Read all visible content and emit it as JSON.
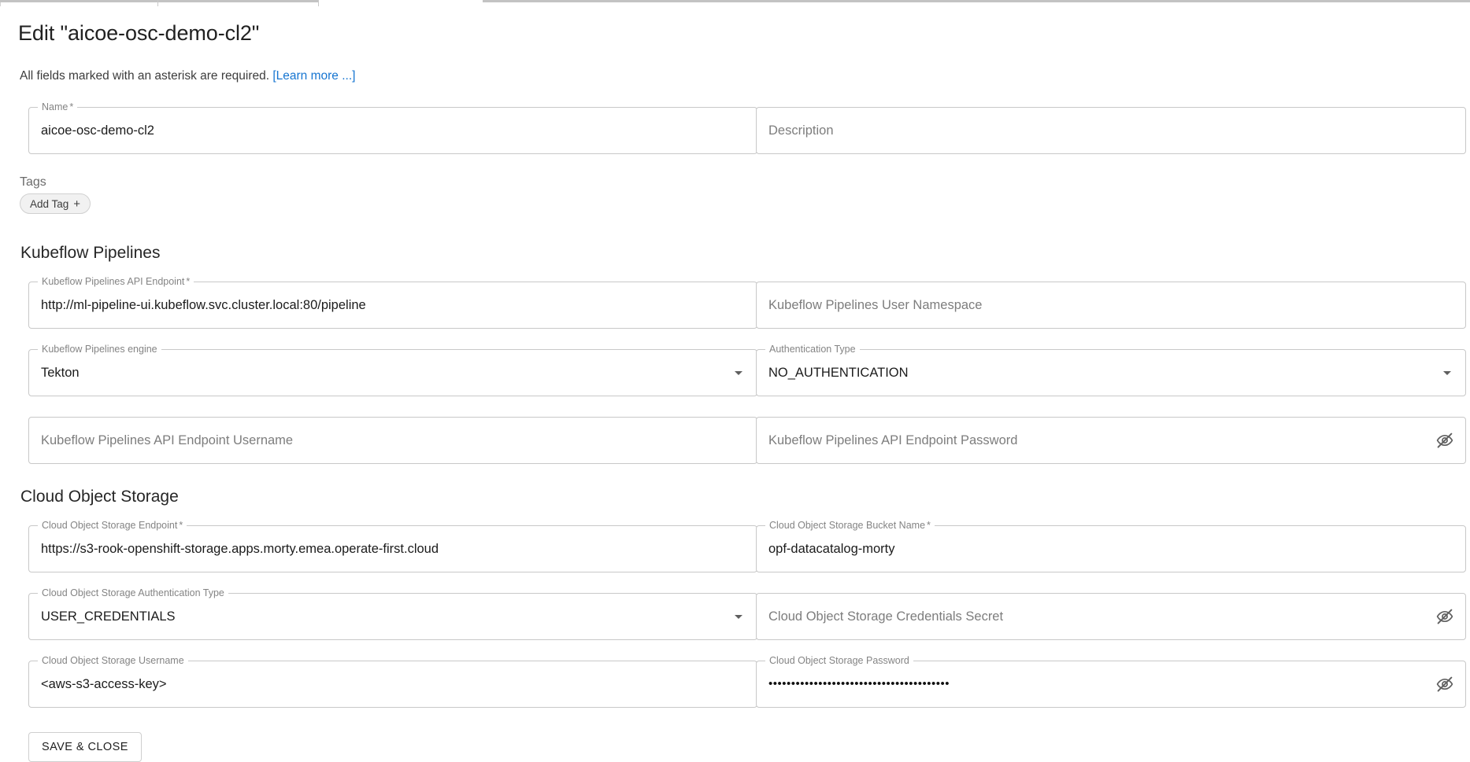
{
  "page": {
    "title": "Edit \"aicoe-osc-demo-cl2\"",
    "subtitle_text": "All fields marked with an asterisk are required.",
    "learn_more_label": "[Learn more ...]",
    "accent_link_color": "#1675d1"
  },
  "tags": {
    "label": "Tags",
    "add_tag_label": "Add Tag",
    "add_tag_glyph": "+"
  },
  "top_fields": {
    "name": {
      "legend": "Name",
      "required_marker": "*",
      "value": "aicoe-osc-demo-cl2"
    },
    "description": {
      "placeholder": "Description",
      "value": ""
    }
  },
  "sections": [
    {
      "title": "Kubeflow Pipelines",
      "fields": {
        "api_endpoint": {
          "legend": "Kubeflow Pipelines API Endpoint",
          "required_marker": "*",
          "value": "http://ml-pipeline-ui.kubeflow.svc.cluster.local:80/pipeline"
        },
        "user_namespace": {
          "placeholder": "Kubeflow Pipelines User Namespace",
          "value": ""
        },
        "engine": {
          "legend": "Kubeflow Pipelines engine",
          "value": "Tekton",
          "icon": "chevron-down-icon"
        },
        "auth_type": {
          "legend": "Authentication Type",
          "value": "NO_AUTHENTICATION",
          "icon": "chevron-down-icon"
        },
        "api_username": {
          "placeholder": "Kubeflow Pipelines API Endpoint Username",
          "value": ""
        },
        "api_password": {
          "placeholder": "Kubeflow Pipelines API Endpoint Password",
          "value": "",
          "icon": "eye-off-icon"
        }
      }
    },
    {
      "title": "Cloud Object Storage",
      "fields": {
        "endpoint": {
          "legend": "Cloud Object Storage Endpoint",
          "required_marker": "*",
          "value": "https://s3-rook-openshift-storage.apps.morty.emea.operate-first.cloud"
        },
        "bucket_name": {
          "legend": "Cloud Object Storage Bucket Name",
          "required_marker": "*",
          "value": "opf-datacatalog-morty"
        },
        "auth_type": {
          "legend": "Cloud Object Storage Authentication Type",
          "value": "USER_CREDENTIALS",
          "icon": "chevron-down-icon"
        },
        "credentials_secret": {
          "placeholder": "Cloud Object Storage Credentials Secret",
          "value": "",
          "icon": "eye-off-icon"
        },
        "username": {
          "legend": "Cloud Object Storage Username",
          "value": "<aws-s3-access-key>"
        },
        "password": {
          "legend": "Cloud Object Storage Password",
          "value": "••••••••••••••••••••••••••••••••••••••••",
          "icon": "eye-off-icon"
        }
      }
    }
  ],
  "footer": {
    "save_close_label": "SAVE & CLOSE"
  }
}
